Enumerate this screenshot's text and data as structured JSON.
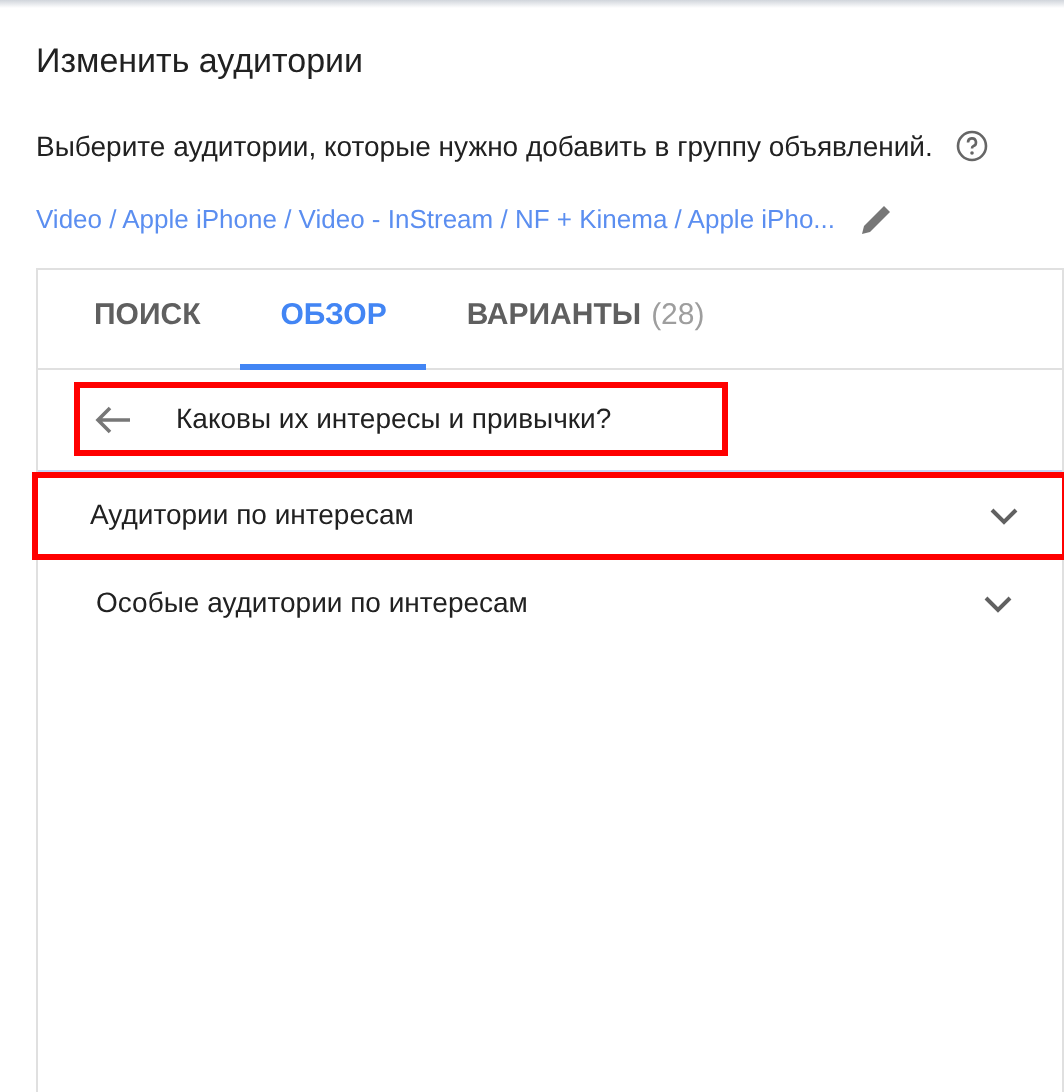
{
  "dialog": {
    "title": "Изменить аудитории",
    "instruction": "Выберите аудитории, которые нужно добавить в группу объявлений.",
    "breadcrumb": "Video / Apple iPhone / Video - InStream / NF + Kinema / Apple iPho..."
  },
  "tabs": [
    {
      "label": "ПОИСК",
      "selected": false
    },
    {
      "label": "ОБЗОР",
      "selected": true
    },
    {
      "label": "ВАРИАНТЫ",
      "count": "(28)",
      "selected": false
    }
  ],
  "back_header": {
    "text": "Каковы их интересы и привычки?",
    "highlighted": true
  },
  "categories": [
    {
      "label": "Аудитории по интересам",
      "expanded": false,
      "highlighted": true
    },
    {
      "label": "Особые аудитории по интересам",
      "expanded": false,
      "highlighted": false
    }
  ]
}
